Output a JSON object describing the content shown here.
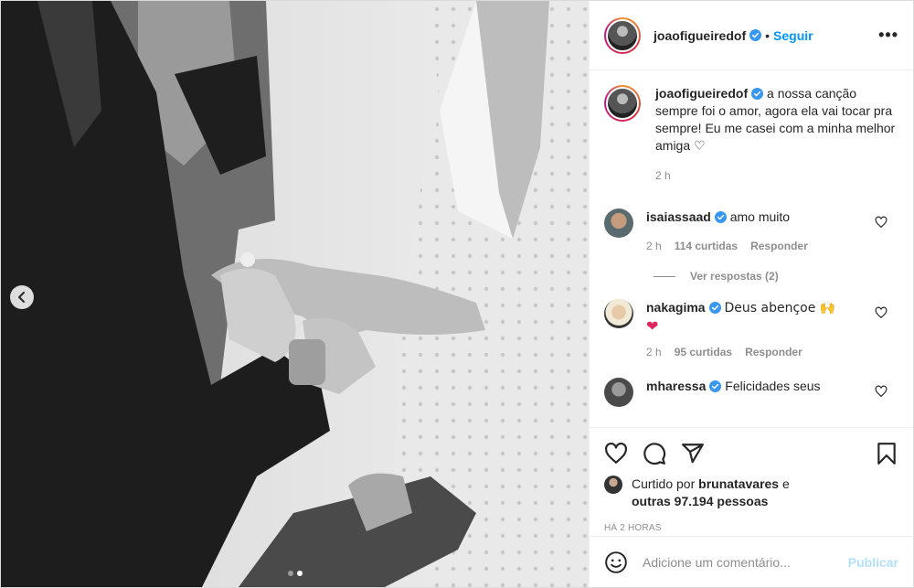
{
  "post": {
    "author": "joaofigueiredof",
    "separator": "•",
    "follow_label": "Seguir",
    "more_label": "•••",
    "caption": "a nossa canção sempre foi o amor, agora ela vai tocar pra sempre! Eu me casei com a minha melhor amiga ♡",
    "caption_time": "2 h"
  },
  "comments": [
    {
      "user": "isaiassaad",
      "text": "amo muito",
      "time": "2 h",
      "likes": "114 curtidas",
      "reply_label": "Responder",
      "view_replies": "Ver respostas (2)"
    },
    {
      "user": "nakagima",
      "text": "Deus abençoe 🙌",
      "emoji_line": "❤",
      "time": "2 h",
      "likes": "95 curtidas",
      "reply_label": "Responder"
    },
    {
      "user": "mharessa",
      "text": "Felicidades seus"
    }
  ],
  "likes_summary": {
    "prefix": "Curtido por",
    "user": "brunatavares",
    "middle": "e",
    "others": "outras 97.194 pessoas"
  },
  "timestamp": "HÁ 2 HORAS",
  "add_comment": {
    "placeholder": "Adicione um comentário...",
    "publish_label": "Publicar"
  },
  "carousel": {
    "total": 2,
    "current": 2
  },
  "colors": {
    "accent": "#0095f6",
    "verified": "#3897f0",
    "publish_disabled": "#b2dffc"
  }
}
